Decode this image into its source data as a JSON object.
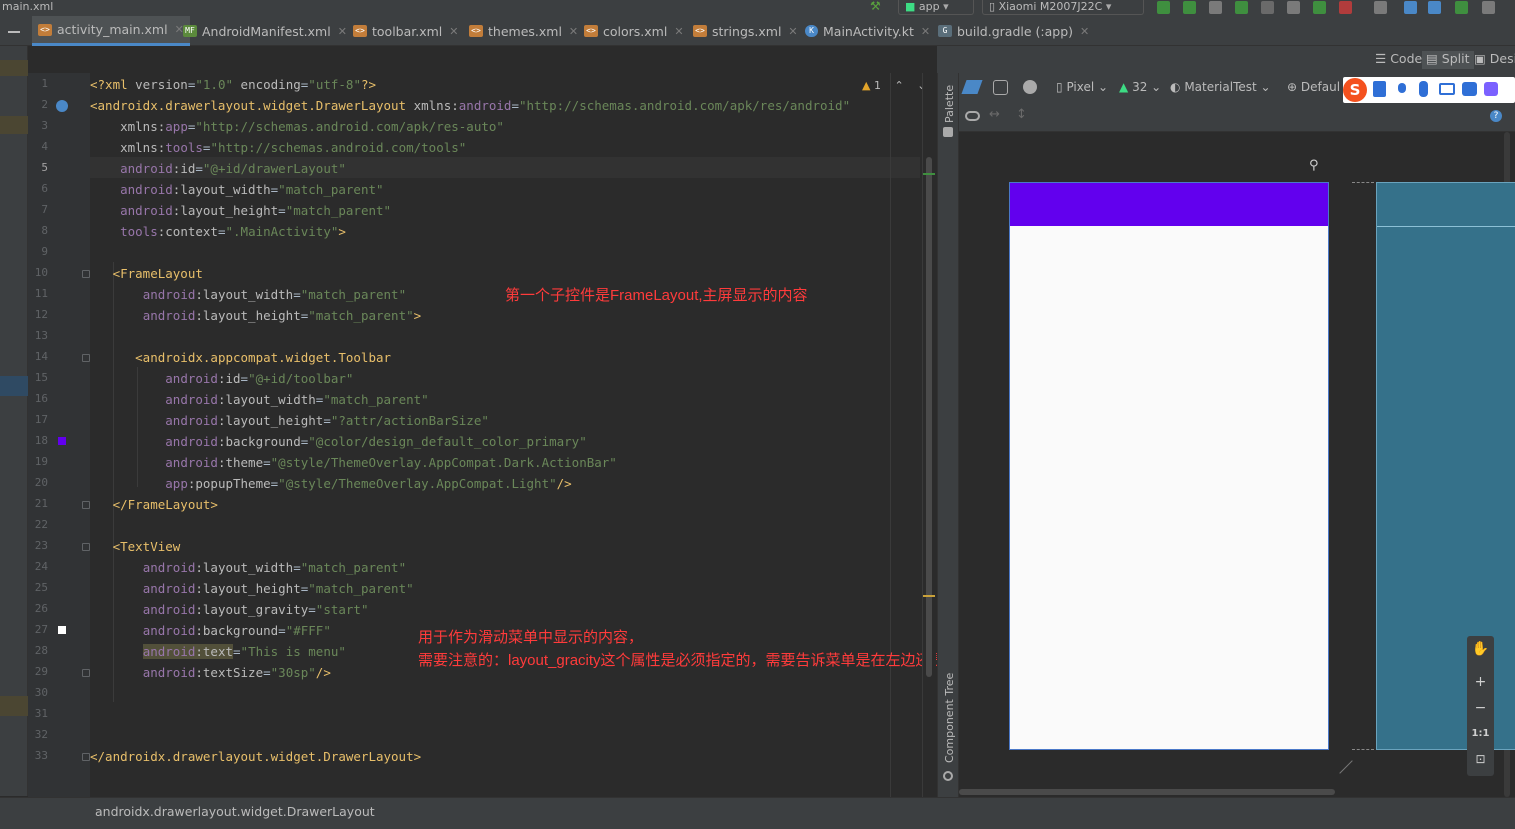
{
  "topbar": {
    "breadcrumb": "main.xml",
    "run_config": "app",
    "device": "Xiaomi M2007J22C"
  },
  "tabs": [
    {
      "label": "activity_main.xml",
      "icon": "xml-file-icon",
      "active": true
    },
    {
      "label": "AndroidManifest.xml",
      "icon": "manifest-file-icon"
    },
    {
      "label": "toolbar.xml",
      "icon": "xml-file-icon"
    },
    {
      "label": "themes.xml",
      "icon": "xml-file-icon"
    },
    {
      "label": "colors.xml",
      "icon": "xml-file-icon"
    },
    {
      "label": "strings.xml",
      "icon": "xml-file-icon"
    },
    {
      "label": "MainActivity.kt",
      "icon": "kotlin-file-icon"
    },
    {
      "label": "build.gradle (:app)",
      "icon": "gradle-file-icon"
    }
  ],
  "view_modes": {
    "code": "Code",
    "split": "Split",
    "design": "Desi"
  },
  "design_toolbar": {
    "device": "Pixel",
    "api": "32",
    "theme": "MaterialTest",
    "locale": "Defaul"
  },
  "side_panels": {
    "palette": "Palette",
    "component_tree": "Component Tree"
  },
  "inspection": {
    "warnings": "1"
  },
  "zoom": {
    "zoom_in": "+",
    "zoom_out": "−",
    "actual_size": "1:1"
  },
  "code_lines": [
    {
      "n": "1",
      "indent": "",
      "parts": [
        [
          "pi",
          "<?xml "
        ],
        [
          "ap",
          "version"
        ],
        [
          "txt",
          "="
        ],
        [
          "v",
          "\"1.0\""
        ],
        [
          "txt",
          " "
        ],
        [
          "ap",
          "encoding"
        ],
        [
          "txt",
          "="
        ],
        [
          "v",
          "\"utf-8\""
        ],
        [
          "pi",
          "?>"
        ]
      ]
    },
    {
      "n": "2",
      "indent": "",
      "parts": [
        [
          "t",
          "<androidx.drawerlayout.widget.DrawerLayout "
        ],
        [
          "ap",
          "xmlns:"
        ],
        [
          "an",
          "android"
        ],
        [
          "txt",
          "="
        ],
        [
          "v",
          "\"http://schemas.android.com/apk/res/android\""
        ]
      ]
    },
    {
      "n": "3",
      "indent": "    ",
      "parts": [
        [
          "ap",
          "xmlns:"
        ],
        [
          "an",
          "app"
        ],
        [
          "txt",
          "="
        ],
        [
          "v",
          "\"http://schemas.android.com/apk/res-auto\""
        ]
      ]
    },
    {
      "n": "4",
      "indent": "    ",
      "parts": [
        [
          "ap",
          "xmlns:"
        ],
        [
          "an",
          "tools"
        ],
        [
          "txt",
          "="
        ],
        [
          "v",
          "\"http://schemas.android.com/tools\""
        ]
      ]
    },
    {
      "n": "5",
      "indent": "    ",
      "parts": [
        [
          "an",
          "android"
        ],
        [
          "ap",
          ":id"
        ],
        [
          "txt",
          "="
        ],
        [
          "v",
          "\"@+id/drawerLayout\""
        ]
      ]
    },
    {
      "n": "6",
      "indent": "    ",
      "parts": [
        [
          "an",
          "android"
        ],
        [
          "ap",
          ":layout_width"
        ],
        [
          "txt",
          "="
        ],
        [
          "v",
          "\"match_parent\""
        ]
      ]
    },
    {
      "n": "7",
      "indent": "    ",
      "parts": [
        [
          "an",
          "android"
        ],
        [
          "ap",
          ":layout_height"
        ],
        [
          "txt",
          "="
        ],
        [
          "v",
          "\"match_parent\""
        ]
      ]
    },
    {
      "n": "8",
      "indent": "    ",
      "parts": [
        [
          "an",
          "tools"
        ],
        [
          "ap",
          ":context"
        ],
        [
          "txt",
          "="
        ],
        [
          "v",
          "\".MainActivity\""
        ],
        [
          "t",
          ">"
        ]
      ]
    },
    {
      "n": "9",
      "indent": "",
      "parts": []
    },
    {
      "n": "10",
      "indent": "   ",
      "parts": [
        [
          "t",
          "<FrameLayout"
        ]
      ]
    },
    {
      "n": "11",
      "indent": "       ",
      "parts": [
        [
          "an",
          "android"
        ],
        [
          "ap",
          ":layout_width"
        ],
        [
          "txt",
          "="
        ],
        [
          "v",
          "\"match_parent\""
        ]
      ]
    },
    {
      "n": "12",
      "indent": "       ",
      "parts": [
        [
          "an",
          "android"
        ],
        [
          "ap",
          ":layout_height"
        ],
        [
          "txt",
          "="
        ],
        [
          "v",
          "\"match_parent\""
        ],
        [
          "t",
          ">"
        ]
      ]
    },
    {
      "n": "13",
      "indent": "",
      "parts": []
    },
    {
      "n": "14",
      "indent": "      ",
      "parts": [
        [
          "t",
          "<androidx.appcompat.widget.Toolbar"
        ]
      ]
    },
    {
      "n": "15",
      "indent": "          ",
      "parts": [
        [
          "an",
          "android"
        ],
        [
          "ap",
          ":id"
        ],
        [
          "txt",
          "="
        ],
        [
          "v",
          "\"@+id/toolbar\""
        ]
      ]
    },
    {
      "n": "16",
      "indent": "          ",
      "parts": [
        [
          "an",
          "android"
        ],
        [
          "ap",
          ":layout_width"
        ],
        [
          "txt",
          "="
        ],
        [
          "v",
          "\"match_parent\""
        ]
      ]
    },
    {
      "n": "17",
      "indent": "          ",
      "parts": [
        [
          "an",
          "android"
        ],
        [
          "ap",
          ":layout_height"
        ],
        [
          "txt",
          "="
        ],
        [
          "v",
          "\"?attr/actionBarSize\""
        ]
      ]
    },
    {
      "n": "18",
      "indent": "          ",
      "parts": [
        [
          "an",
          "android"
        ],
        [
          "ap",
          ":background"
        ],
        [
          "txt",
          "="
        ],
        [
          "v",
          "\"@color/design_default_color_primary\""
        ]
      ]
    },
    {
      "n": "19",
      "indent": "          ",
      "parts": [
        [
          "an",
          "android"
        ],
        [
          "ap",
          ":theme"
        ],
        [
          "txt",
          "="
        ],
        [
          "v",
          "\"@style/ThemeOverlay.AppCompat.Dark.ActionBar\""
        ]
      ]
    },
    {
      "n": "20",
      "indent": "          ",
      "parts": [
        [
          "an",
          "app"
        ],
        [
          "ap",
          ":popupTheme"
        ],
        [
          "txt",
          "="
        ],
        [
          "v",
          "\"@style/ThemeOverlay.AppCompat.Light\""
        ],
        [
          "t",
          "/>"
        ]
      ]
    },
    {
      "n": "21",
      "indent": "   ",
      "parts": [
        [
          "t",
          "</FrameLayout>"
        ]
      ]
    },
    {
      "n": "22",
      "indent": "",
      "parts": []
    },
    {
      "n": "23",
      "indent": "   ",
      "parts": [
        [
          "t",
          "<TextView"
        ]
      ]
    },
    {
      "n": "24",
      "indent": "       ",
      "parts": [
        [
          "an",
          "android"
        ],
        [
          "ap",
          ":layout_width"
        ],
        [
          "txt",
          "="
        ],
        [
          "v",
          "\"match_parent\""
        ]
      ]
    },
    {
      "n": "25",
      "indent": "       ",
      "parts": [
        [
          "an",
          "android"
        ],
        [
          "ap",
          ":layout_height"
        ],
        [
          "txt",
          "="
        ],
        [
          "v",
          "\"match_parent\""
        ]
      ]
    },
    {
      "n": "26",
      "indent": "       ",
      "parts": [
        [
          "an",
          "android"
        ],
        [
          "ap",
          ":layout_gravity"
        ],
        [
          "txt",
          "="
        ],
        [
          "v",
          "\"start\""
        ]
      ]
    },
    {
      "n": "27",
      "indent": "       ",
      "parts": [
        [
          "an",
          "android"
        ],
        [
          "ap",
          ":background"
        ],
        [
          "txt",
          "="
        ],
        [
          "v",
          "\"#FFF\""
        ]
      ]
    },
    {
      "n": "28",
      "indent": "       ",
      "parts": [
        [
          "an",
          "android"
        ],
        [
          "ap",
          ":text"
        ],
        [
          "txt",
          "="
        ],
        [
          "v",
          "\"This is menu\""
        ]
      ]
    },
    {
      "n": "29",
      "indent": "       ",
      "parts": [
        [
          "an",
          "android"
        ],
        [
          "ap",
          ":textSize"
        ],
        [
          "txt",
          "="
        ],
        [
          "v",
          "\"30sp\""
        ],
        [
          "t",
          "/>"
        ]
      ]
    },
    {
      "n": "30",
      "indent": "",
      "parts": []
    },
    {
      "n": "31",
      "indent": "",
      "parts": []
    },
    {
      "n": "32",
      "indent": "",
      "parts": []
    },
    {
      "n": "33",
      "indent": "",
      "parts": [
        [
          "t",
          "</androidx.drawerlayout.widget.DrawerLayout>"
        ]
      ]
    }
  ],
  "annotations": {
    "note1": "第一个子控件是FrameLayout,主屏显示的内容",
    "note2_line1": "用于作为滑动菜单中显示的内容，",
    "note2_line2": "需要注意的：layout_gracity这个属性是必须指定的，需要告诉菜单是在左边还是右边"
  },
  "status": {
    "breadcrumb": "androidx.drawerlayout.widget.DrawerLayout"
  },
  "colors": {
    "toolbar_primary": "#6200EE",
    "blueprint": "#35718A",
    "editor_bg": "#2B2B2B",
    "note_red": "#FF3B3B"
  }
}
